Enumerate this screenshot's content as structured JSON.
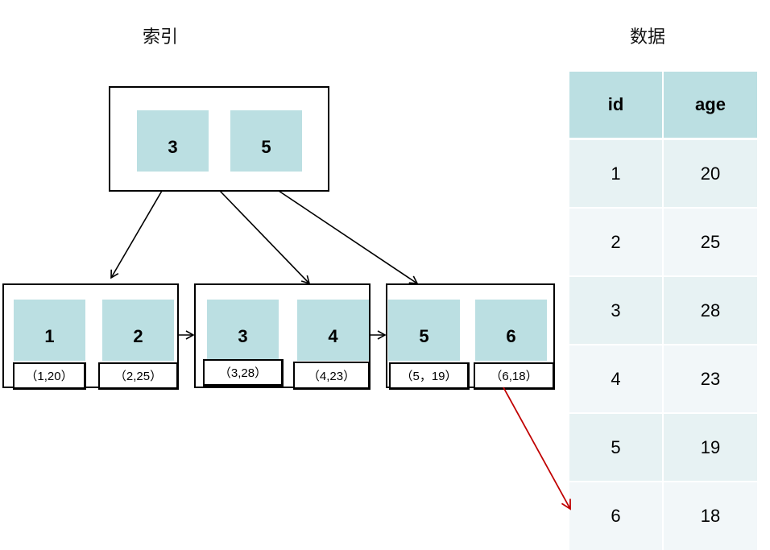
{
  "titles": {
    "index": "索引",
    "data": "数据"
  },
  "colors": {
    "key_fill": "#bbdfe2",
    "header_fill": "#bbdfe2",
    "row_odd": "#e7f2f3",
    "row_even": "#f2f7f9",
    "pointer_arrow": "#c00000",
    "tree_arrow": "#000000"
  },
  "root": {
    "keys": [
      "3",
      "5"
    ]
  },
  "leaves": [
    {
      "keys": [
        "1",
        "2"
      ],
      "rows": [
        "（1,20）",
        "（2,25）"
      ]
    },
    {
      "keys": [
        "3",
        "4"
      ],
      "rows": [
        "（3,28）",
        "（4,23）"
      ]
    },
    {
      "keys": [
        "5",
        "6"
      ],
      "rows": [
        "（5，19）",
        "（6,18）"
      ]
    }
  ],
  "table": {
    "headers": [
      "id",
      "age"
    ],
    "rows": [
      [
        "1",
        "20"
      ],
      [
        "2",
        "25"
      ],
      [
        "3",
        "28"
      ],
      [
        "4",
        "23"
      ],
      [
        "5",
        "19"
      ],
      [
        "6",
        "18"
      ]
    ]
  },
  "pointer": {
    "from": "（6,18）",
    "to_row_id": "6"
  }
}
